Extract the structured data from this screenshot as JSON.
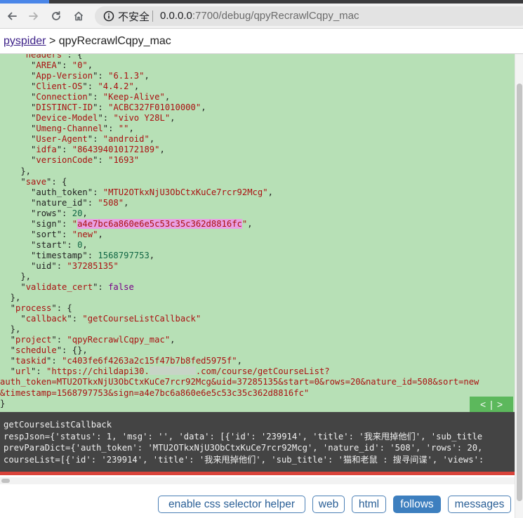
{
  "browser": {
    "security_label": "不安全",
    "url_host": "0.0.0.0",
    "url_rest": ":7700/debug/qpyRecrawlCqpy_mac"
  },
  "header": {
    "root_link": "pyspider",
    "separator": ">",
    "project": "qpyRecrawlCqpy_mac"
  },
  "code": {
    "headers_key": "headers",
    "headers": [
      {
        "k": "AREA",
        "v": "0"
      },
      {
        "k": "App-Version",
        "v": "6.1.3"
      },
      {
        "k": "Client-OS",
        "v": "4.4.2"
      },
      {
        "k": "Connection",
        "v": "Keep-Alive"
      },
      {
        "k": "DISTINCT-ID",
        "v": "ACBC327F01010000"
      },
      {
        "k": "Device-Model",
        "v": "vivo Y28L"
      },
      {
        "k": "Umeng-Channel",
        "v": ""
      },
      {
        "k": "User-Agent",
        "v": "android"
      },
      {
        "k": "idfa",
        "v": "864394010172189"
      },
      {
        "k": "versionCode",
        "v": "1693"
      }
    ],
    "save_key": "save",
    "save": {
      "auth_token": "MTU2OTkxNjU3ObCtxKuCe7rcr92Mcg",
      "nature_id": "508",
      "rows": "20",
      "sign": "a4e7bc6a860e6e5c53c35c362d8816fc",
      "sort": "new",
      "start": "0",
      "timestamp": "1568797753",
      "uid": "37285135"
    },
    "validate_cert_key": "validate_cert",
    "validate_cert": "false",
    "process_key": "process",
    "callback_key": "callback",
    "callback": "getCourseListCallback",
    "project_key": "project",
    "project": "qpyRecrawlCqpy_mac",
    "schedule_key": "schedule",
    "schedule": "{}",
    "taskid_key": "taskid",
    "taskid": "c403fe6f4263a2c15f47b7b8fed5975f",
    "url_key": "url",
    "url_start": "https://childapi30.",
    "url_end": ".com/course/getCourseList?",
    "url_line2": "auth_token=MTU2OTkxNjU3ObCtxKuCe7rcr92Mcg&uid=37285135&start=0&rows=20&nature_id=508&sort=new",
    "url_line3": "&timestamp=1568797753&sign=a4e7bc6a860e6e5c53c35c362d8816fc\""
  },
  "pager": {
    "prev": "<",
    "divider": "|",
    "next": ">"
  },
  "console": {
    "lines": [
      "getCourseListCallback",
      "respJson={'status': 1, 'msg': '', 'data': [{'id': '239914', 'title': '我来甩掉他们', 'sub_title",
      "prevParaDict={'auth_token': 'MTU2OTkxNjU3ObCtxKuCe7rcr92Mcg', 'nature_id': '508', 'rows': 20,",
      "courseList=[{'id': '239914', 'title': '我来甩掉他们', 'sub_title': '猫和老鼠 : 搜寻间谍', 'views':"
    ]
  },
  "buttons": {
    "css_helper": "enable css selector helper",
    "web": "web",
    "html": "html",
    "follows": "follows",
    "messages": "messages"
  },
  "colors": {
    "code_bg": "#b7e0b6",
    "console_bg": "#444444",
    "active_button": "#3d7fbf",
    "error_bar": "#d9433a"
  }
}
